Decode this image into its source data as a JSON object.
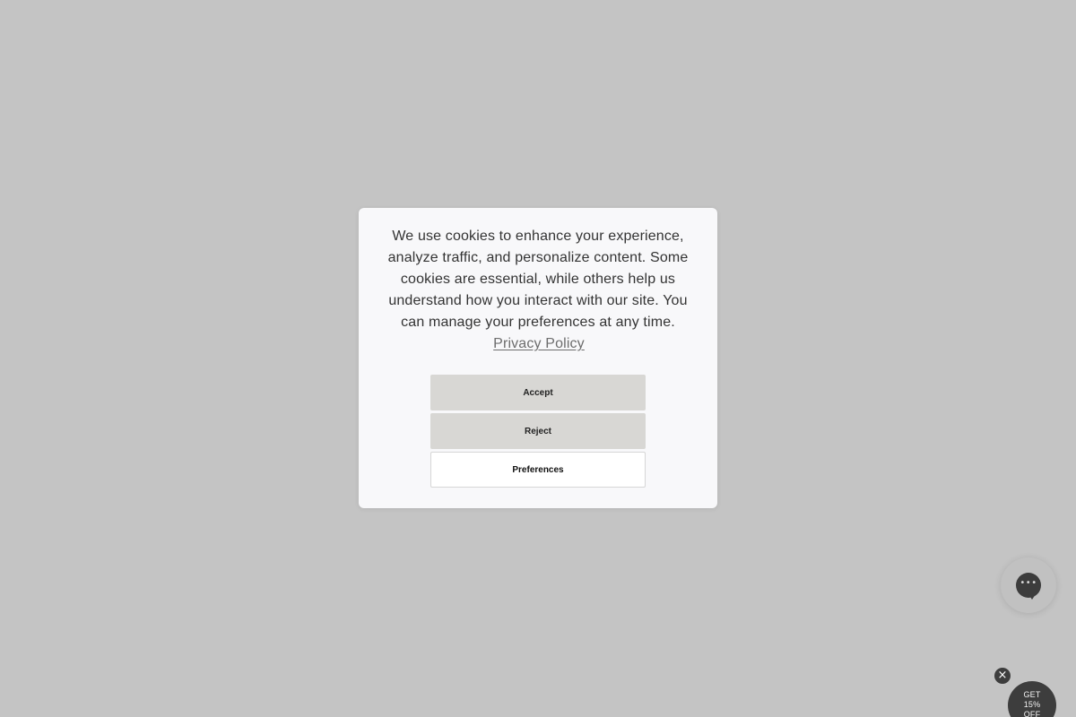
{
  "cookie_banner": {
    "message": "We use cookies to enhance your experience, analyze traffic, and personalize content. Some cookies are essential, while others help us understand how you interact with our site. You can manage your preferences at any time.",
    "privacy_link_label": "Privacy Policy",
    "buttons": {
      "accept_label": "Accept",
      "reject_label": "Reject",
      "preferences_label": "Preferences"
    }
  },
  "widgets": {
    "chat_launcher": {
      "icon": "chat-bubble-icon"
    },
    "promo": {
      "close_icon": "close-icon",
      "line1": "GET",
      "line2": "15%",
      "line3": "OFF"
    }
  },
  "colors": {
    "overlay_background": "#c4c4c4",
    "modal_background": "#f8f8fa",
    "primary_button": "#d8d7d4",
    "secondary_button": "#ffffff",
    "text": "#333333",
    "widget_dark": "#3d3d3d"
  }
}
